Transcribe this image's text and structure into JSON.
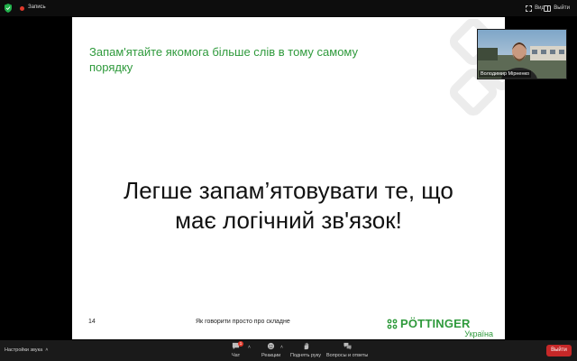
{
  "topbar": {
    "recording_label": "Запись",
    "view_label": "Вид",
    "exit_label": "Выйти"
  },
  "slide": {
    "heading": "Запам'ятайте якомога більше слів в тому самому порядку",
    "main_line1": "Легше запам’ятовувати те, що",
    "main_line2": "має логічний зв'язок!",
    "page_number": "14",
    "footer_text": "Як говорити просто про складне",
    "logo_text": "PÖTTINGER",
    "logo_subtext": "Україна"
  },
  "participant": {
    "name": "Володимир Мірненко"
  },
  "toolbar": {
    "audio_settings": "Настройки звука",
    "chat_label": "Чат",
    "chat_badge": "1",
    "reactions_label": "Реакции",
    "raise_hand_label": "Поднять руку",
    "qa_label": "Вопросы и ответы",
    "leave_label": "Выйти"
  },
  "colors": {
    "brand_green": "#2f9a3c",
    "leave_red": "#c62828",
    "record_red": "#e0392b"
  }
}
